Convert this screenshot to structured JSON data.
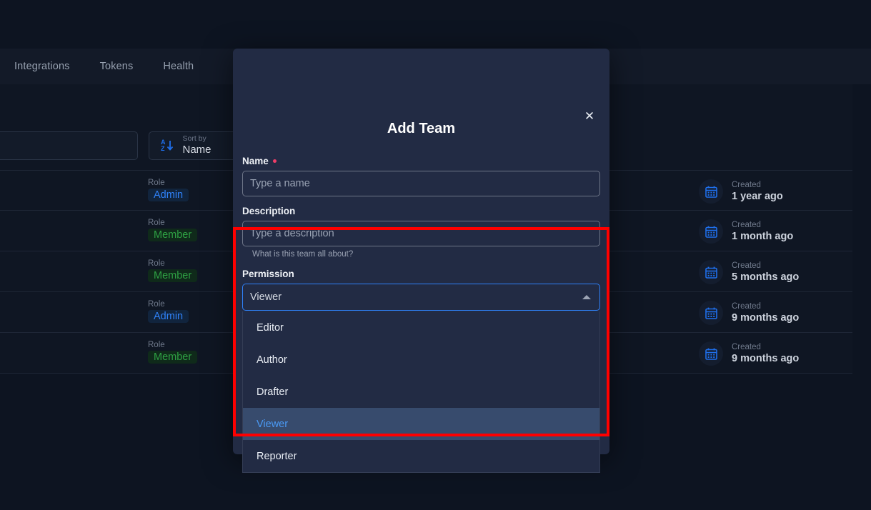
{
  "topnav": {
    "items": [
      {
        "label": "Integrations"
      },
      {
        "label": "Tokens"
      },
      {
        "label": "Health"
      }
    ]
  },
  "toolbar": {
    "search_placeholder": "",
    "sort": {
      "icon": "sort-alpha-asc-icon",
      "label": "Sort by",
      "value": "Name"
    }
  },
  "table": {
    "role_header": "Role",
    "created_header": "Created",
    "rows": [
      {
        "role_label": "Role",
        "role": "Admin",
        "role_kind": "admin",
        "created_label": "Created",
        "created": "1 year ago"
      },
      {
        "role_label": "Role",
        "role": "Member",
        "role_kind": "member",
        "created_label": "Created",
        "created": "1 month ago"
      },
      {
        "role_label": "Role",
        "role": "Member",
        "role_kind": "member",
        "created_label": "Created",
        "created": "5 months ago"
      },
      {
        "role_label": "Role",
        "role": "Admin",
        "role_kind": "admin",
        "created_label": "Created",
        "created": "9 months ago"
      },
      {
        "role_label": "Role",
        "role": "Member",
        "role_kind": "member",
        "created_label": "Created",
        "created": "9 months ago"
      }
    ]
  },
  "modal": {
    "title": "Add Team",
    "close_icon": "close-icon",
    "name": {
      "label": "Name",
      "required": true,
      "value": "",
      "placeholder": "Type a name"
    },
    "description": {
      "label": "Description",
      "value": "",
      "placeholder": "Type a description",
      "helper": "What is this team all about?"
    },
    "permission": {
      "label": "Permission",
      "selected": "Viewer",
      "expanded": true,
      "caret_icon": "chevron-up-icon",
      "options": [
        {
          "label": "Editor",
          "selected": false
        },
        {
          "label": "Author",
          "selected": false
        },
        {
          "label": "Drafter",
          "selected": false
        },
        {
          "label": "Viewer",
          "selected": true
        },
        {
          "label": "Reporter",
          "selected": false
        }
      ]
    }
  },
  "annotation": {
    "highlight_color": "#ff0000"
  },
  "colors": {
    "page_bg": "#0d1421",
    "content_bg": "#0f1623",
    "modal_bg": "#222b44",
    "accent_blue": "#2f81f7",
    "admin_badge": "#2f81f7",
    "member_badge": "#2ea043",
    "required_dot": "#ef3d68",
    "option_selected_bg": "#374b6d"
  }
}
